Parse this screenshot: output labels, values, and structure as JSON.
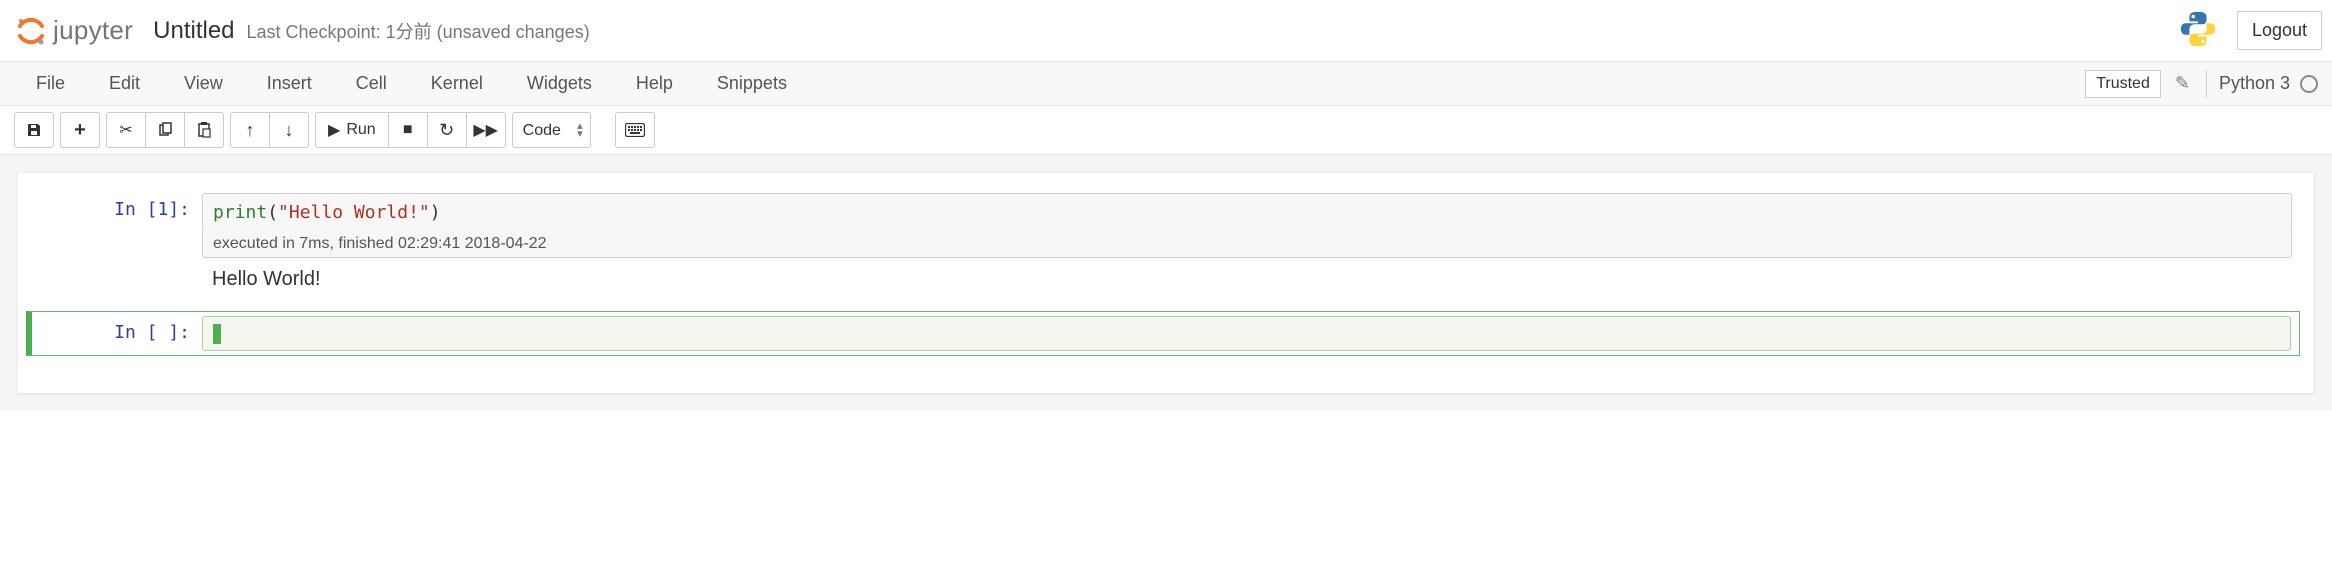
{
  "header": {
    "logo_text": "jupyter",
    "notebook_name": "Untitled",
    "checkpoint": "Last Checkpoint: 1分前   (unsaved changes)",
    "logout": "Logout"
  },
  "menubar": {
    "items": [
      "File",
      "Edit",
      "View",
      "Insert",
      "Cell",
      "Kernel",
      "Widgets",
      "Help",
      "Snippets"
    ],
    "trusted": "Trusted",
    "kernel_name": "Python 3"
  },
  "toolbar": {
    "run_label": "Run",
    "celltype": "Code"
  },
  "cells": [
    {
      "prompt_prefix": "In [",
      "prompt_num": "1",
      "prompt_suffix": "]:",
      "code_func": "print",
      "code_open": "(",
      "code_str": "\"Hello World!\"",
      "code_close": ")",
      "exec_info": "executed in 7ms, finished 02:29:41 2018-04-22",
      "output": "Hello World!"
    },
    {
      "prompt_prefix": "In [ ",
      "prompt_num": "",
      "prompt_suffix": "]:"
    }
  ]
}
